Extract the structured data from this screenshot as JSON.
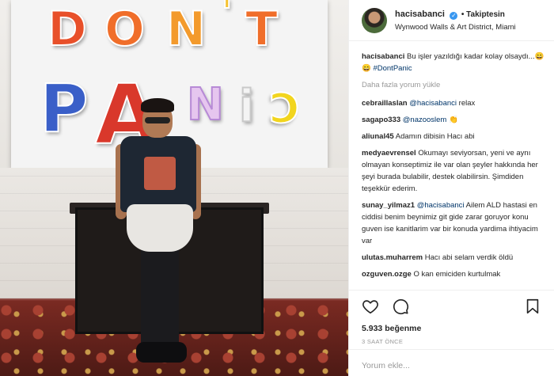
{
  "post": {
    "username": "hacisabanci",
    "follow_status": "• Takiptesin",
    "location": "Wynwood Walls & Art District, Miami",
    "verified_glyph": "✓"
  },
  "caption": {
    "username": "hacisabanci",
    "text": "Bu işler yazıldığı kadar kolay olsaydı...😄😄 ",
    "hashtag": "#DontPanic"
  },
  "load_more_label": "Daha fazla yorum yükle",
  "comments": [
    {
      "username": "cebraillaslan",
      "mention": "@hacisabanci",
      "text": " relax"
    },
    {
      "username": "sagapo333",
      "mention": "@nazooslem",
      "text": " 👏"
    },
    {
      "username": "aliunal45",
      "mention": "",
      "text": "Adamın dibisin Hacı abi"
    },
    {
      "username": "medyaevrensel",
      "mention": "",
      "text": "Okumayı seviyorsan, yeni ve aynı olmayan konseptimiz ile var olan şeyler hakkında her şeyi burada bulabilir, destek olabilirsin. Şimdiden teşekkür ederim."
    },
    {
      "username": "sunay_yilmaz1",
      "mention": "@hacisabanci",
      "text": " Ailem ALD hastasi en ciddisi benim beynimiz git gide zarar goruyor konu guven ise kanitlarim var bir konuda yardima ihtiyacim var"
    },
    {
      "username": "ulutas.muharrem",
      "mention": "",
      "text": "Hacı abi selam verdik öldü"
    },
    {
      "username": "ozguven.ozge",
      "mention": "",
      "text": "O kan emiciden kurtulmak"
    }
  ],
  "likes": "5.933 beğenme",
  "timestamp": "3 SAAT ÖNCE",
  "comment_input": {
    "placeholder": "Yorum ekle..."
  },
  "sign": {
    "row1": [
      "D",
      "O",
      "N",
      "'",
      "T"
    ],
    "row2": [
      "P",
      "A",
      "N",
      "i",
      "C"
    ],
    "colors": [
      "#e8502a",
      "#f06e2a",
      "#f39a2c",
      "#f6c230",
      "#3a5fc8",
      "#d9382b",
      "#e8e4ef",
      "#f4f4f4",
      "#f2d51e"
    ]
  }
}
